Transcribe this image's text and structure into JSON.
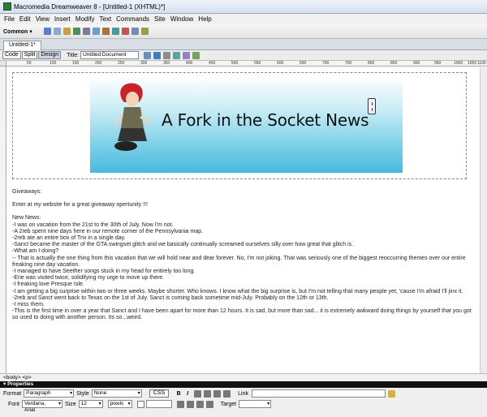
{
  "window": {
    "title": "Macromedia Dreamweaver 8 - [Untitled-1 (XHTML)*]"
  },
  "menu": [
    "File",
    "Edit",
    "View",
    "Insert",
    "Modify",
    "Text",
    "Commands",
    "Site",
    "Window",
    "Help"
  ],
  "insert_bar": {
    "category": "Common"
  },
  "document_tab": {
    "label": "Untitled-1*"
  },
  "doc_toolbar": {
    "views": [
      "Code",
      "Split",
      "Design"
    ],
    "active_view": "Design",
    "title_label": "Title:",
    "title_value": "Untitled Document"
  },
  "ruler": {
    "ticks": [
      "50",
      "100",
      "150",
      "200",
      "250",
      "300",
      "350",
      "400",
      "450",
      "500",
      "550",
      "600",
      "650",
      "700",
      "750",
      "800",
      "850",
      "900",
      "950",
      "1000",
      "1050",
      "1100"
    ]
  },
  "banner": {
    "title": "A Fork in the Socket News"
  },
  "content": {
    "giveaways_heading": "Giveaways:",
    "giveaways_text": "Enter at my website for a great giveaway opertunity !!!",
    "news_heading": "New News:",
    "news_lines": [
      "-I was on vacation from the 21st to the 30th of July. Now I'm not.",
      "-A 2reb spent nine days here in our remote corner of the Pennsylvania map.",
      "-2reb ate an entire box of Trix in a single day.",
      "-Sanct became the master of the GTA swingset glitch and we basically continually screamed ourselves silly over how great that glitch is.",
      "-What am I doing?",
      "-- That is actually the one thing from this vacation that we will hold near and dear forever. No, I'm not joking. That was seriously one of the biggest reoccurring themes over our entire freaking nine day vacation.",
      "-I managed to have Seether songs stuck in my head for entirely too long.",
      "-Erie was visited twice, solidifying my urge to move up there.",
      "-I freaking love Presque Isle.",
      "-I am getting a big surprise within two or three weeks. Maybe shorter. Who knows. I know what the big surprise is, but I'm not telling that many people yet, 'cause I'm afraid I'll jinx it.",
      "-2reb and Sanct went back to Texas on the 1st of July. Sanct is coming back sometime mid-July. Probably on the 12th or 13th.",
      "-I miss them.",
      "-This is the first time in over a year that Sanct and I have been apart for more than 12 hours. It is sad, but more than sad... it is extremely awkward doing things by yourself that you got so used to doing with another person. Its so...weird."
    ]
  },
  "status_bar": {
    "tag_selector": "<body> <p>"
  },
  "properties": {
    "header": "Properties",
    "format_label": "Format",
    "format_value": "Paragraph",
    "style_label": "Style",
    "style_value": "None",
    "css_button": "CSS",
    "bold": "B",
    "italic": "I",
    "link_label": "Link",
    "font_label": "Font",
    "font_value": "Verdana, Arial",
    "size_label": "Size",
    "size_value": "12",
    "units_value": "pixels",
    "target_label": "Target"
  }
}
